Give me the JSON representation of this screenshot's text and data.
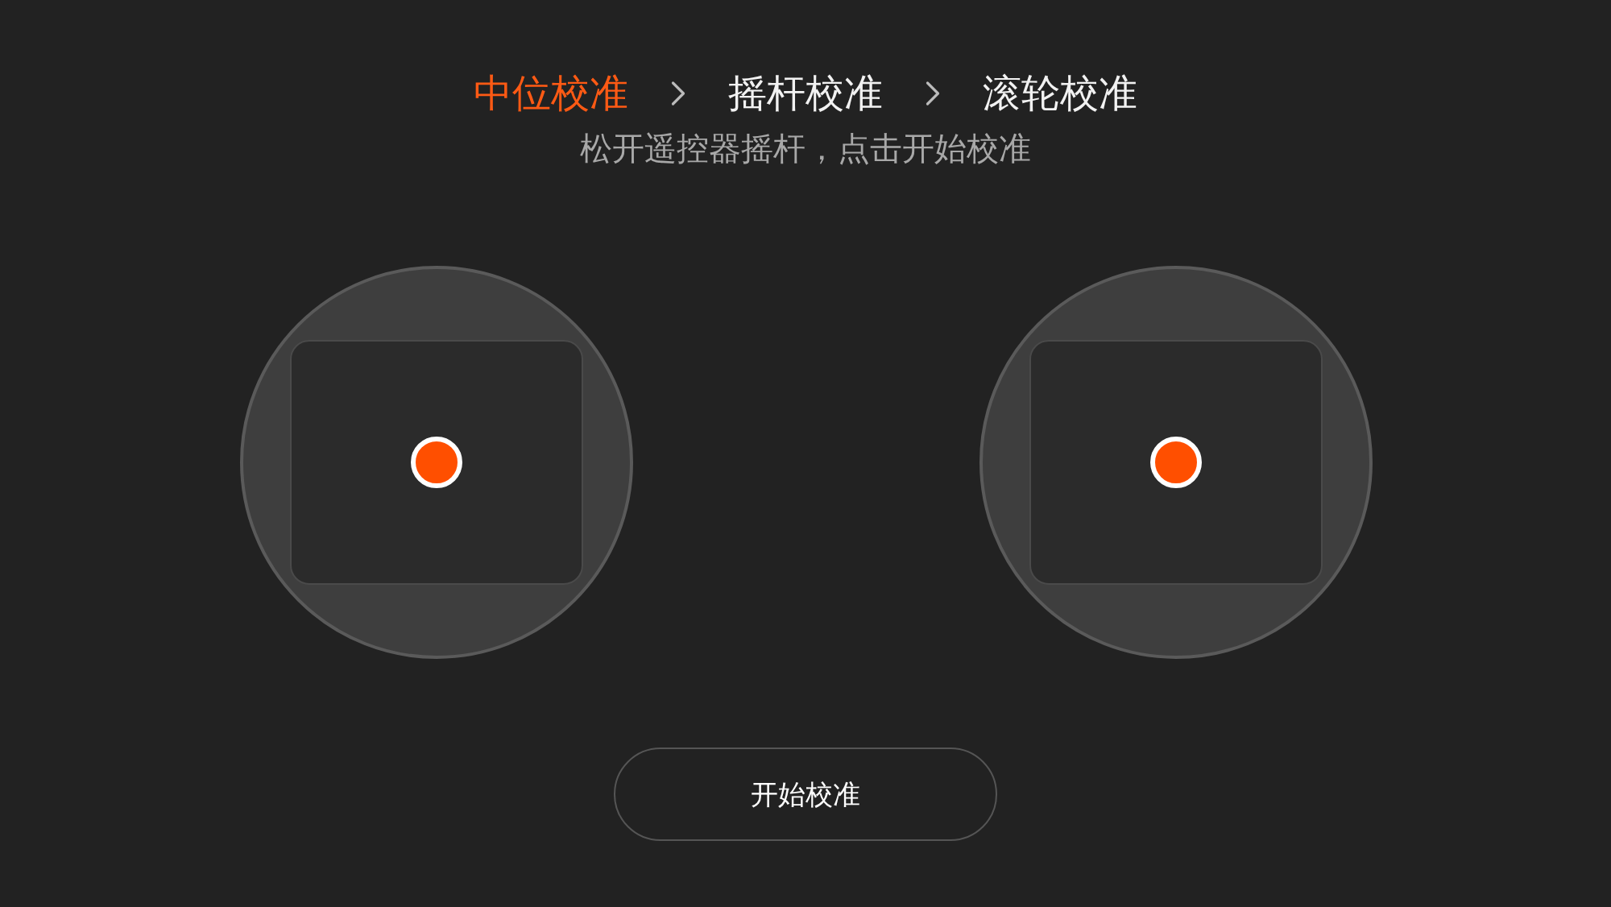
{
  "steps": [
    {
      "label": "中位校准",
      "selected": true
    },
    {
      "label": "摇杆校准",
      "selected": false
    },
    {
      "label": "滚轮校准",
      "selected": false
    }
  ],
  "instruction": "松开遥控器摇杆，点击开始校准",
  "sticks": [
    {
      "kind": "joystick"
    },
    {
      "kind": "joystick"
    }
  ],
  "start_button": "开始校准"
}
